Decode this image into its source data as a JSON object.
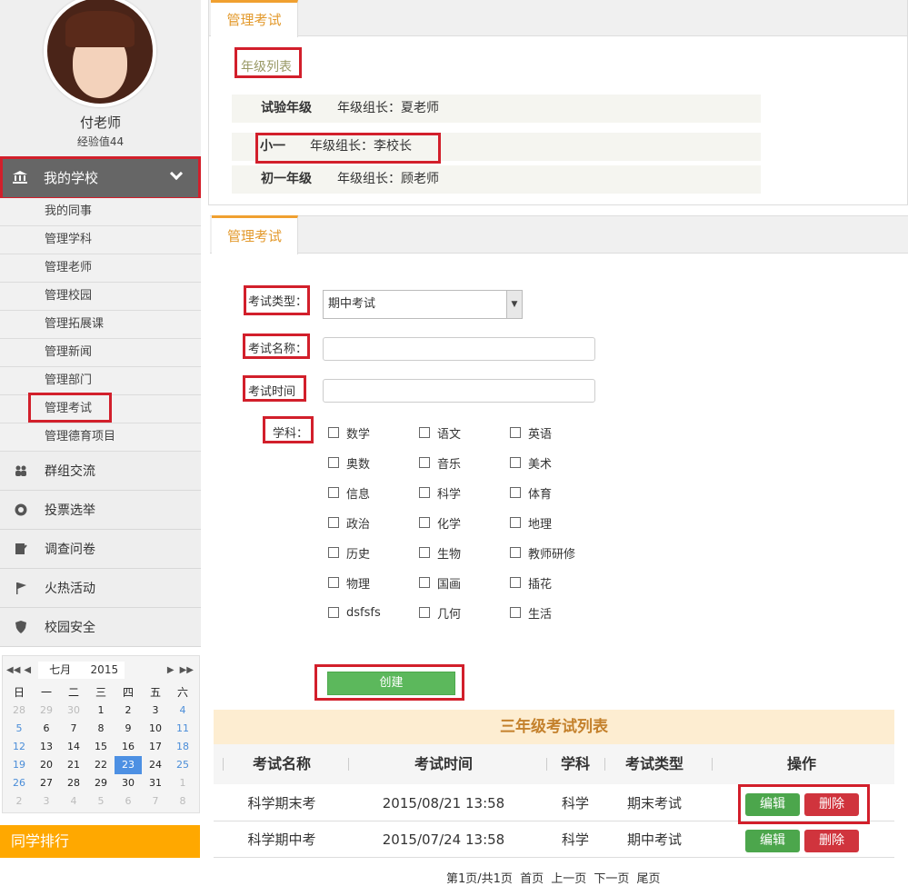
{
  "sidebar": {
    "user_name": "付老师",
    "experience": "经验值44",
    "main_menu": {
      "label": "我的学校",
      "icon": "school-icon"
    },
    "sub_items": [
      {
        "label": "我的同事"
      },
      {
        "label": "管理学科"
      },
      {
        "label": "管理老师"
      },
      {
        "label": "管理校园"
      },
      {
        "label": "管理拓展课"
      },
      {
        "label": "管理新闻"
      },
      {
        "label": "管理部门"
      },
      {
        "label": "管理考试"
      },
      {
        "label": "管理德育项目"
      }
    ],
    "groups": [
      {
        "label": "群组交流",
        "icon": "people-icon"
      },
      {
        "label": "投票选举",
        "icon": "vote-icon"
      },
      {
        "label": "调查问卷",
        "icon": "survey-icon"
      },
      {
        "label": "火热活动",
        "icon": "flag-icon"
      },
      {
        "label": "校园安全",
        "icon": "shield-icon"
      }
    ],
    "calendar": {
      "month": "七月",
      "year": "2015",
      "weekdays": [
        "日",
        "一",
        "二",
        "三",
        "四",
        "五",
        "六"
      ],
      "days": [
        "28",
        "29",
        "30",
        "1",
        "2",
        "3",
        "4",
        "5",
        "6",
        "7",
        "8",
        "9",
        "10",
        "11",
        "12",
        "13",
        "14",
        "15",
        "16",
        "17",
        "18",
        "19",
        "20",
        "21",
        "22",
        "23",
        "24",
        "25",
        "26",
        "27",
        "28",
        "29",
        "30",
        "31",
        "1",
        "2",
        "3",
        "4",
        "5",
        "6",
        "7",
        "8"
      ],
      "today": "23"
    },
    "rank_title": "同学排行"
  },
  "top_panel": {
    "tab": "管理考试",
    "grade_list_link": "年级列表",
    "grades": [
      {
        "name": "试验年级",
        "leader": "年级组长：夏老师"
      },
      {
        "name": "小一",
        "leader": "年级组长：李校长"
      },
      {
        "name": "初一年级",
        "leader": "年级组长：顾老师"
      }
    ]
  },
  "form_panel": {
    "tab": "管理考试",
    "labels": {
      "exam_type": "考试类型：",
      "exam_name": "考试名称：",
      "exam_time": "考试时间",
      "subject": "学科："
    },
    "exam_type_value": "期中考试",
    "exam_name_value": "",
    "exam_time_value": "",
    "subjects": [
      "数学",
      "语文",
      "英语",
      "奥数",
      "音乐",
      "美术",
      "信息",
      "科学",
      "体育",
      "政治",
      "化学",
      "地理",
      "历史",
      "生物",
      "教师研修",
      "物理",
      "国画",
      "插花",
      "dsfsfs",
      "几何",
      "生活"
    ],
    "create_label": "创建"
  },
  "exam_table": {
    "title": "三年级考试列表",
    "headers": {
      "name": "考试名称",
      "time": "考试时间",
      "subject": "学科",
      "type": "考试类型",
      "ops": "操作"
    },
    "rows": [
      {
        "name": "科学期末考",
        "time": "2015/08/21 13:58",
        "subject": "科学",
        "type": "期末考试"
      },
      {
        "name": "科学期中考",
        "time": "2015/07/24 13:58",
        "subject": "科学",
        "type": "期中考试"
      }
    ],
    "edit_label": "编辑",
    "delete_label": "删除"
  },
  "pager": {
    "info": "第1页/共1页",
    "first": "首页",
    "prev": "上一页",
    "next": "下一页",
    "last": "尾页"
  },
  "colors": {
    "accent_orange": "#f0a030",
    "highlight_red": "#d21f2b",
    "create_green": "#5cb85c",
    "delete_red": "#d0343d",
    "calendar_today": "#4d90e3"
  }
}
